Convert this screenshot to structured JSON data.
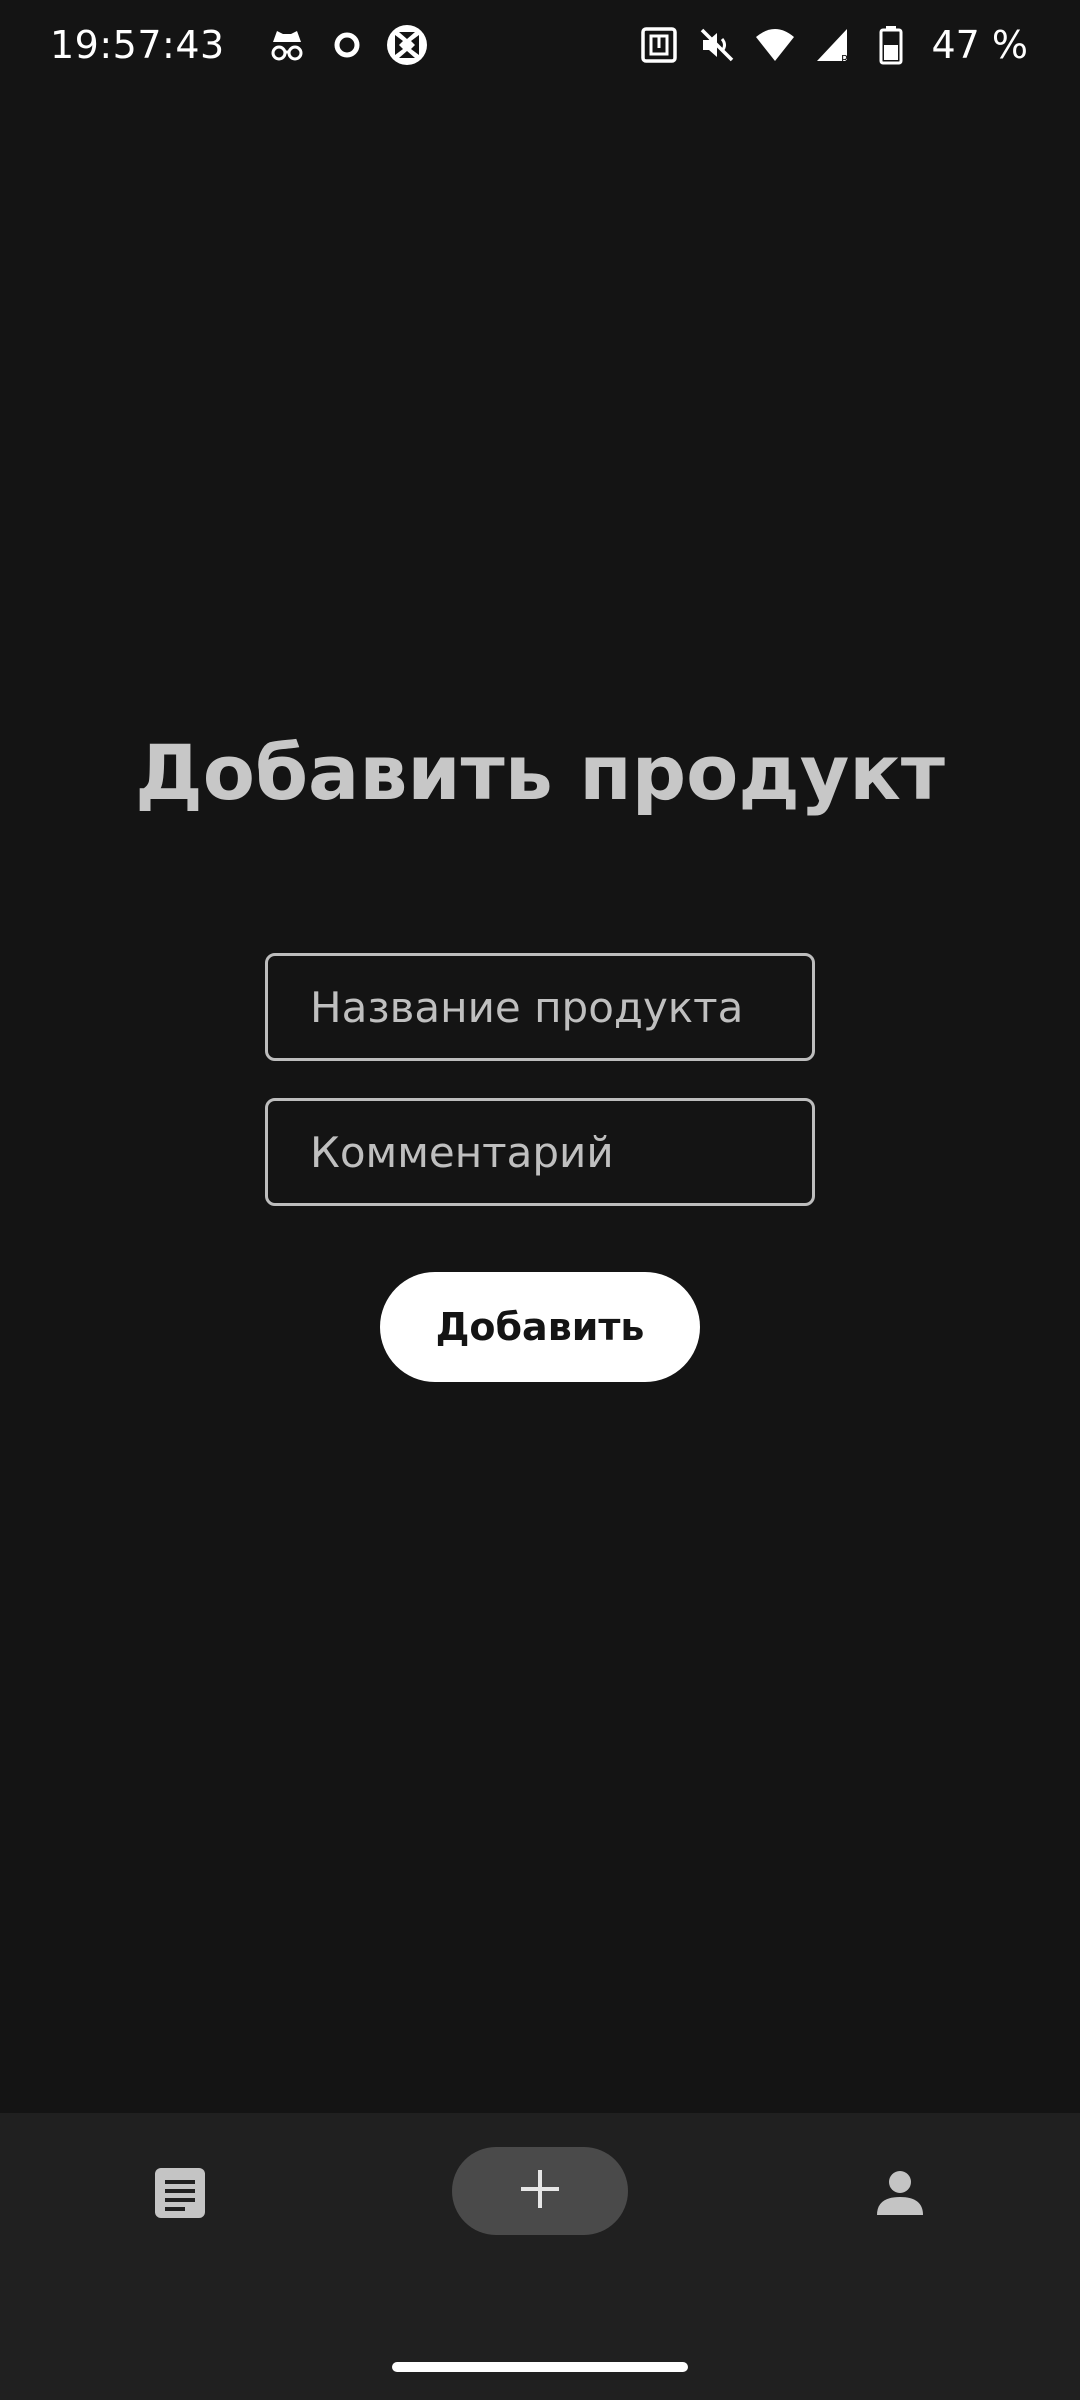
{
  "status_bar": {
    "time": "19:57:43",
    "battery_percent": "47 %",
    "left_icons": [
      "incognito-icon",
      "circle-icon",
      "app-badge-icon"
    ],
    "right_icons": [
      "nfc-icon",
      "vibrate-off-icon",
      "wifi-icon",
      "signal-icon",
      "battery-icon"
    ]
  },
  "page": {
    "title": "Добавить продукт"
  },
  "form": {
    "name_placeholder": "Название продукта",
    "comment_placeholder": "Комментарий",
    "submit_label": "Добавить"
  },
  "bottom_nav": {
    "items": [
      {
        "icon": "list-icon"
      },
      {
        "icon": "plus-icon",
        "selected": true
      },
      {
        "icon": "profile-icon"
      }
    ]
  },
  "colors": {
    "background": "#141414",
    "nav_background": "#202020",
    "selected_pill": "#4a4a4a",
    "title": "#c7c7c7"
  }
}
